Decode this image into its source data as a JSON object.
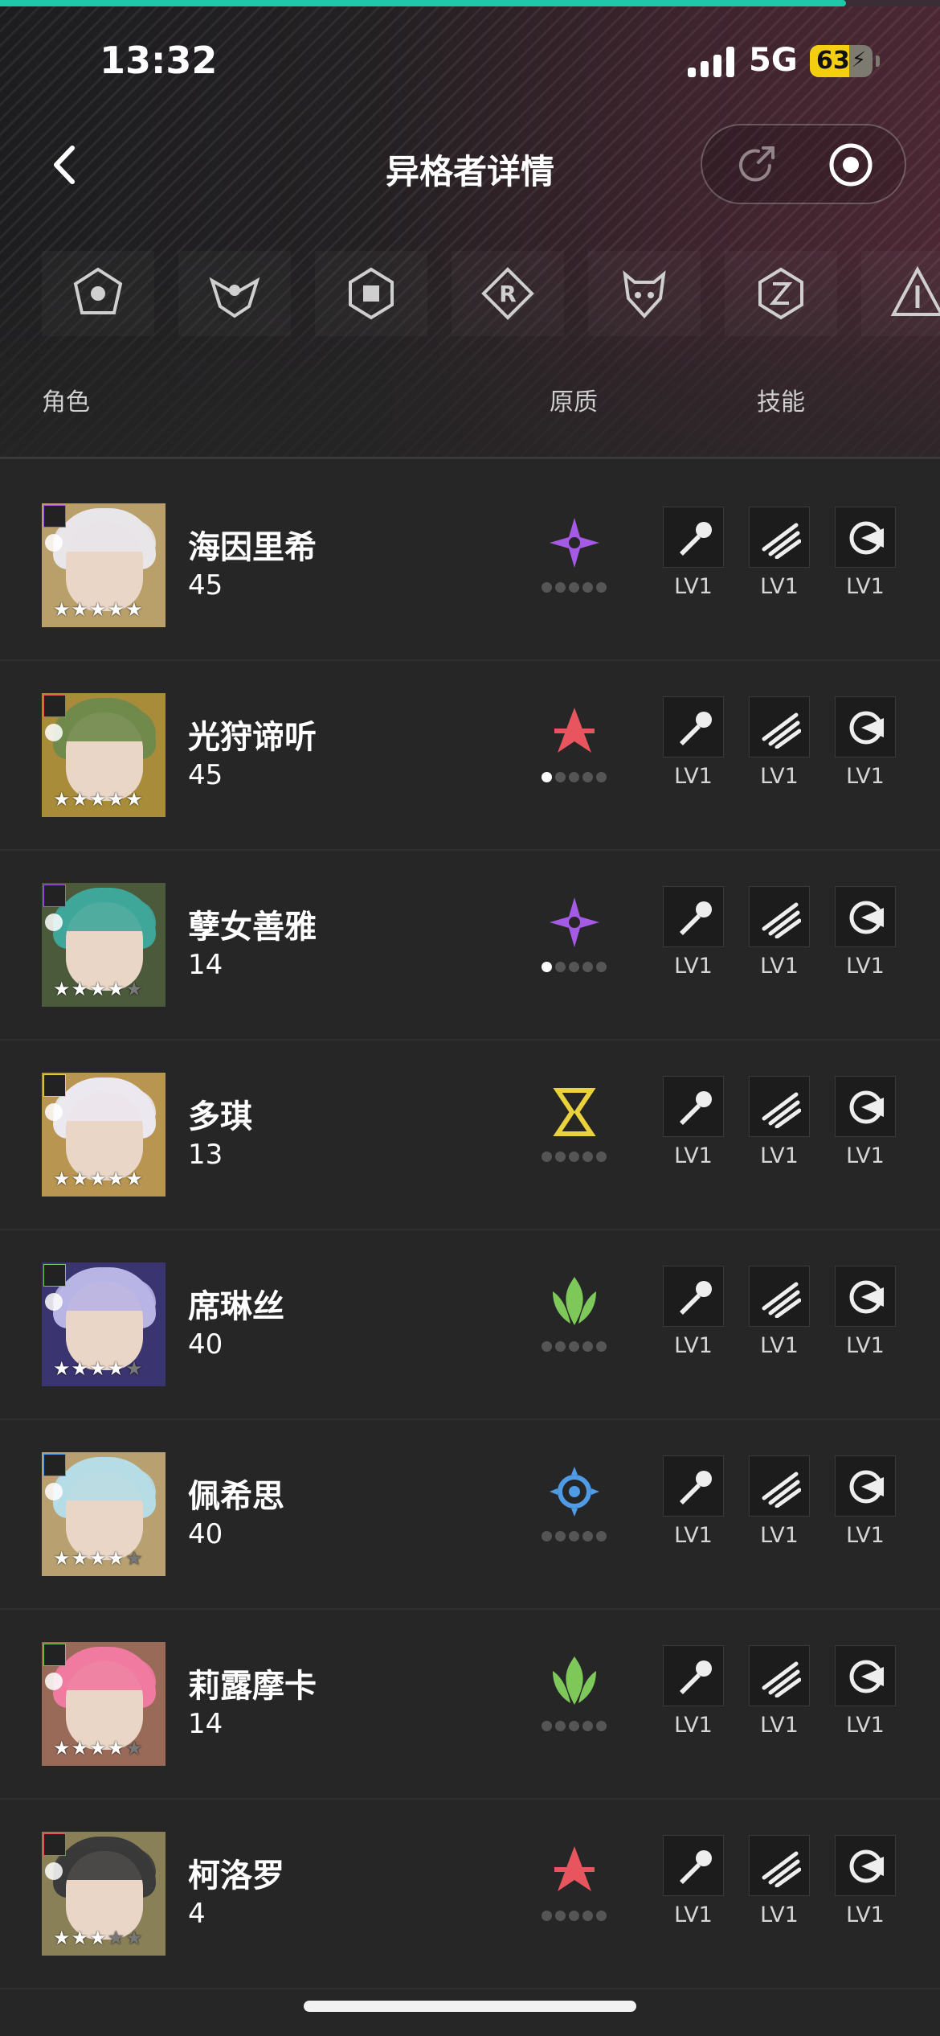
{
  "status_bar": {
    "time": "13:32",
    "network": "5G",
    "battery": "63",
    "battery_fraction": 0.63
  },
  "top_progress_fraction": 0.9,
  "nav": {
    "title": "异格者详情"
  },
  "factions": [
    "faction-1",
    "faction-2",
    "faction-3",
    "faction-4",
    "faction-5",
    "faction-6",
    "faction-7"
  ],
  "columns": {
    "character": "角色",
    "quality": "原质",
    "skills": "技能"
  },
  "element_colors": {
    "purple": "#a45ae6",
    "red": "#e8555f",
    "yellow": "#e9d23c",
    "green": "#7ec85a",
    "blue": "#4f9be6"
  },
  "characters": [
    {
      "name": "海因里希",
      "level": "45",
      "element": "purple",
      "quality_dots": 0,
      "stars": 5,
      "hair": "#e9e6ea",
      "bg": "#b9a06b",
      "skills": [
        "LV1",
        "LV1",
        "LV1"
      ]
    },
    {
      "name": "光狩谛听",
      "level": "45",
      "element": "red",
      "quality_dots": 1,
      "stars": 5,
      "hair": "#6f8a4a",
      "bg": "#a88c3a",
      "skills": [
        "LV1",
        "LV1",
        "LV1"
      ]
    },
    {
      "name": "孽女善雅",
      "level": "14",
      "element": "purple",
      "quality_dots": 1,
      "stars": 4,
      "hair": "#3fa79a",
      "bg": "#4c5a3c",
      "skills": [
        "LV1",
        "LV1",
        "LV1"
      ]
    },
    {
      "name": "多琪",
      "level": "13",
      "element": "yellow",
      "quality_dots": 0,
      "stars": 5,
      "hair": "#ece8f0",
      "bg": "#b89550",
      "skills": [
        "LV1",
        "LV1",
        "LV1"
      ]
    },
    {
      "name": "席琳丝",
      "level": "40",
      "element": "green",
      "quality_dots": 0,
      "stars": 4,
      "hair": "#b8b4e4",
      "bg": "#3a3470",
      "skills": [
        "LV1",
        "LV1",
        "LV1"
      ]
    },
    {
      "name": "佩希思",
      "level": "40",
      "element": "blue",
      "quality_dots": 0,
      "stars": 4,
      "hair": "#b6dde6",
      "bg": "#b8a070",
      "skills": [
        "LV1",
        "LV1",
        "LV1"
      ]
    },
    {
      "name": "莉露摩卡",
      "level": "14",
      "element": "green",
      "quality_dots": 0,
      "stars": 4,
      "hair": "#f07aa0",
      "bg": "#9a6a58",
      "skills": [
        "LV1",
        "LV1",
        "LV1"
      ]
    },
    {
      "name": "柯洛罗",
      "level": "4",
      "element": "red",
      "quality_dots": 0,
      "stars": 3,
      "hair": "#3a3a3a",
      "bg": "#8a8058",
      "skills": [
        "LV1",
        "LV1",
        "LV1"
      ]
    }
  ]
}
